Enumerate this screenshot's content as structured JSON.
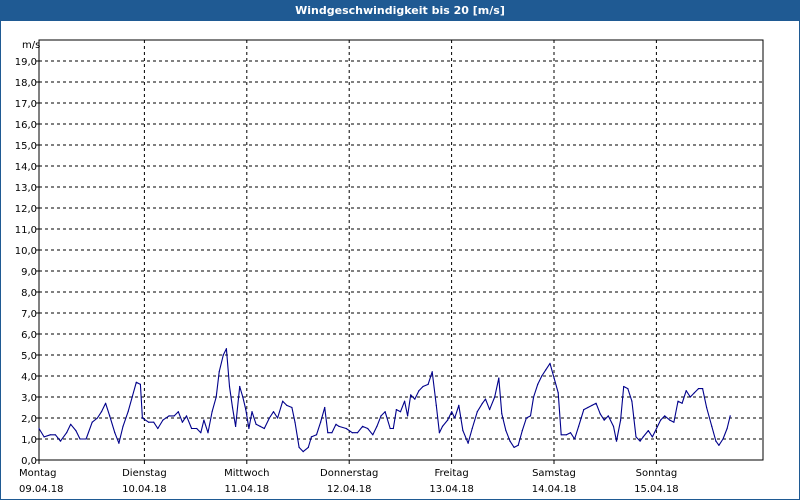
{
  "window": {
    "title": "Windgeschwindigkeit bis 20 [m/s]"
  },
  "chart_data": {
    "type": "line",
    "title": "Windgeschwindigkeit bis 20 [m/s]",
    "yunit": "m/s",
    "ylim": [
      0,
      20
    ],
    "yticks": [
      "0,0",
      "1,0",
      "2,0",
      "3,0",
      "4,0",
      "5,0",
      "6,0",
      "7,0",
      "8,0",
      "9,0",
      "10,0",
      "11,0",
      "12,0",
      "13,0",
      "14,0",
      "15,0",
      "16,0",
      "17,0",
      "18,0",
      "19,0"
    ],
    "xlim": [
      0,
      7
    ],
    "x_unit": "days from Montag 09.04.18 00:00",
    "xticks": [
      {
        "day": "Montag",
        "date": "09.04.18"
      },
      {
        "day": "Dienstag",
        "date": "10.04.18"
      },
      {
        "day": "Mittwoch",
        "date": "11.04.18"
      },
      {
        "day": "Donnerstag",
        "date": "12.04.18"
      },
      {
        "day": "Freitag",
        "date": "13.04.18"
      },
      {
        "day": "Samstag",
        "date": "14.04.18"
      },
      {
        "day": "Sonntag",
        "date": "15.04.18"
      }
    ],
    "grid": true,
    "line_color": "#00008b",
    "series": [
      {
        "values": [
          [
            0.0,
            1.5
          ],
          [
            0.05,
            1.1
          ],
          [
            0.11,
            1.2
          ],
          [
            0.16,
            1.2
          ],
          [
            0.21,
            0.9
          ],
          [
            0.27,
            1.3
          ],
          [
            0.31,
            1.7
          ],
          [
            0.36,
            1.4
          ],
          [
            0.4,
            1.0
          ],
          [
            0.46,
            1.0
          ],
          [
            0.52,
            1.8
          ],
          [
            0.57,
            2.0
          ],
          [
            0.61,
            2.3
          ],
          [
            0.65,
            2.7
          ],
          [
            0.69,
            2.1
          ],
          [
            0.74,
            1.3
          ],
          [
            0.78,
            0.8
          ],
          [
            0.82,
            1.6
          ],
          [
            0.87,
            2.3
          ],
          [
            0.91,
            3.0
          ],
          [
            0.95,
            3.7
          ],
          [
            0.99,
            3.6
          ],
          [
            1.01,
            2.0
          ],
          [
            1.07,
            1.8
          ],
          [
            1.12,
            1.8
          ],
          [
            1.16,
            1.5
          ],
          [
            1.21,
            1.9
          ],
          [
            1.27,
            2.1
          ],
          [
            1.32,
            2.1
          ],
          [
            1.36,
            2.3
          ],
          [
            1.4,
            1.8
          ],
          [
            1.44,
            2.1
          ],
          [
            1.49,
            1.5
          ],
          [
            1.54,
            1.5
          ],
          [
            1.58,
            1.3
          ],
          [
            1.61,
            1.9
          ],
          [
            1.65,
            1.3
          ],
          [
            1.69,
            2.3
          ],
          [
            1.73,
            3.0
          ],
          [
            1.76,
            4.2
          ],
          [
            1.8,
            5.0
          ],
          [
            1.83,
            5.3
          ],
          [
            1.86,
            3.5
          ],
          [
            1.89,
            2.5
          ],
          [
            1.92,
            1.6
          ],
          [
            1.96,
            3.5
          ],
          [
            1.99,
            3.0
          ],
          [
            2.02,
            2.4
          ],
          [
            2.05,
            1.5
          ],
          [
            2.08,
            2.3
          ],
          [
            2.12,
            1.7
          ],
          [
            2.16,
            1.6
          ],
          [
            2.2,
            1.5
          ],
          [
            2.25,
            2.0
          ],
          [
            2.29,
            2.3
          ],
          [
            2.33,
            2.0
          ],
          [
            2.38,
            2.8
          ],
          [
            2.42,
            2.6
          ],
          [
            2.47,
            2.5
          ],
          [
            2.5,
            1.8
          ],
          [
            2.54,
            0.6
          ],
          [
            2.58,
            0.4
          ],
          [
            2.63,
            0.6
          ],
          [
            2.66,
            1.1
          ],
          [
            2.71,
            1.2
          ],
          [
            2.75,
            1.8
          ],
          [
            2.79,
            2.5
          ],
          [
            2.82,
            1.3
          ],
          [
            2.86,
            1.3
          ],
          [
            2.9,
            1.7
          ],
          [
            2.93,
            1.6
          ],
          [
            3.0,
            1.5
          ],
          [
            3.06,
            1.3
          ],
          [
            3.11,
            1.3
          ],
          [
            3.16,
            1.6
          ],
          [
            3.21,
            1.5
          ],
          [
            3.26,
            1.2
          ],
          [
            3.3,
            1.6
          ],
          [
            3.34,
            2.1
          ],
          [
            3.38,
            2.3
          ],
          [
            3.43,
            1.5
          ],
          [
            3.46,
            1.5
          ],
          [
            3.49,
            2.4
          ],
          [
            3.53,
            2.3
          ],
          [
            3.57,
            2.8
          ],
          [
            3.6,
            2.1
          ],
          [
            3.63,
            3.1
          ],
          [
            3.67,
            2.9
          ],
          [
            3.71,
            3.3
          ],
          [
            3.75,
            3.5
          ],
          [
            3.8,
            3.6
          ],
          [
            3.84,
            4.2
          ],
          [
            3.88,
            2.6
          ],
          [
            3.91,
            1.3
          ],
          [
            3.94,
            1.6
          ],
          [
            3.99,
            1.9
          ],
          [
            4.03,
            2.3
          ],
          [
            4.06,
            2.0
          ],
          [
            4.1,
            2.6
          ],
          [
            4.14,
            1.4
          ],
          [
            4.19,
            0.8
          ],
          [
            4.23,
            1.5
          ],
          [
            4.28,
            2.3
          ],
          [
            4.33,
            2.7
          ],
          [
            4.36,
            2.9
          ],
          [
            4.4,
            2.4
          ],
          [
            4.45,
            3.0
          ],
          [
            4.49,
            3.9
          ],
          [
            4.52,
            2.2
          ],
          [
            4.56,
            1.4
          ],
          [
            4.6,
            0.9
          ],
          [
            4.64,
            0.6
          ],
          [
            4.68,
            0.7
          ],
          [
            4.72,
            1.4
          ],
          [
            4.76,
            2.0
          ],
          [
            4.8,
            2.1
          ],
          [
            4.83,
            3.0
          ],
          [
            4.87,
            3.6
          ],
          [
            4.91,
            4.0
          ],
          [
            4.95,
            4.3
          ],
          [
            4.99,
            4.6
          ],
          [
            5.03,
            3.9
          ],
          [
            5.07,
            3.2
          ],
          [
            5.1,
            1.2
          ],
          [
            5.15,
            1.2
          ],
          [
            5.19,
            1.3
          ],
          [
            5.23,
            1.0
          ],
          [
            5.27,
            1.6
          ],
          [
            5.32,
            2.4
          ],
          [
            5.36,
            2.5
          ],
          [
            5.4,
            2.6
          ],
          [
            5.44,
            2.7
          ],
          [
            5.48,
            2.2
          ],
          [
            5.52,
            1.9
          ],
          [
            5.56,
            2.1
          ],
          [
            5.61,
            1.6
          ],
          [
            5.64,
            0.9
          ],
          [
            5.68,
            1.9
          ],
          [
            5.71,
            3.5
          ],
          [
            5.75,
            3.4
          ],
          [
            5.79,
            2.8
          ],
          [
            5.83,
            1.1
          ],
          [
            5.87,
            0.9
          ],
          [
            5.9,
            1.1
          ],
          [
            5.95,
            1.4
          ],
          [
            5.99,
            1.1
          ],
          [
            6.03,
            1.5
          ],
          [
            6.07,
            1.9
          ],
          [
            6.11,
            2.1
          ],
          [
            6.16,
            1.9
          ],
          [
            6.2,
            1.8
          ],
          [
            6.24,
            2.8
          ],
          [
            6.28,
            2.7
          ],
          [
            6.32,
            3.3
          ],
          [
            6.36,
            3.0
          ],
          [
            6.4,
            3.2
          ],
          [
            6.44,
            3.4
          ],
          [
            6.48,
            3.4
          ],
          [
            6.52,
            2.5
          ],
          [
            6.57,
            1.6
          ],
          [
            6.61,
            0.9
          ],
          [
            6.64,
            0.7
          ],
          [
            6.68,
            1.0
          ],
          [
            6.72,
            1.5
          ],
          [
            6.75,
            2.1
          ]
        ]
      }
    ]
  }
}
